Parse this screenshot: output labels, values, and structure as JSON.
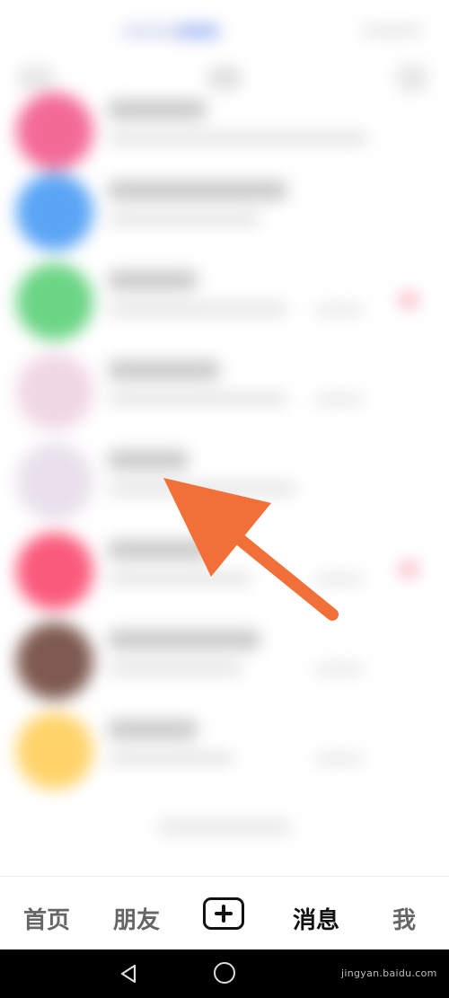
{
  "tab_bar": {
    "home_label": "首页",
    "friends_label": "朋友",
    "add_icon": "plus-square-icon",
    "messages_label": "消息",
    "me_label": "我",
    "active_tab": "消息"
  },
  "nav_bar": {
    "back_icon": "triangle-back-icon",
    "home_icon": "circle-home-icon",
    "watermark": "jingyan.baidu.com"
  },
  "overlay": {
    "arrow_color": "#F07038"
  },
  "colors": {
    "avatar_1": "#F36A97",
    "avatar_2": "#5AA5F5",
    "avatar_3": "#6BD585",
    "avatar_4": "#F0D7E4",
    "avatar_5": "#E9E0EB",
    "avatar_6": "#FA5A7C",
    "avatar_7": "#7E5A50",
    "avatar_8": "#FFD36A",
    "badge": "#F6B3BE"
  }
}
